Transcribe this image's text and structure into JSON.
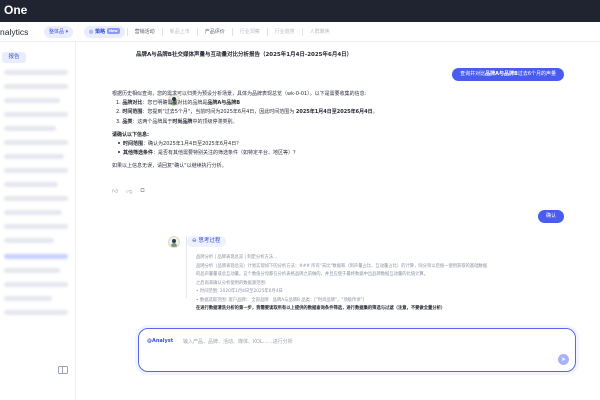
{
  "brand": {
    "logo_text": "One"
  },
  "header": {
    "app_name": "nalytics",
    "workspace": "整体品 ▾",
    "tabs": [
      {
        "label": "策略",
        "badge": "New",
        "state": "active"
      },
      {
        "label": "营销活动",
        "state": "normal"
      },
      {
        "label": "新品上市",
        "state": "dim"
      },
      {
        "label": "产品评价",
        "state": "normal"
      },
      {
        "label": "行业洞察",
        "state": "dim"
      },
      {
        "label": "行业趋势",
        "state": "dim"
      },
      {
        "label": "人群聚焦",
        "state": "dim"
      }
    ]
  },
  "sidebar": {
    "active_label": "报告",
    "items_count_blurred": 18
  },
  "report": {
    "title": "品牌A与品牌B社交媒体声量与互动量对比分析报告（2025年1月4日-2025年6月4日）"
  },
  "chat": {
    "user_message_1": {
      "prefix": "查询并对比",
      "brands": "品牌A与品牌B",
      "suffix": "过去6个月的声量"
    },
    "assistant_message": {
      "intro": "根据历史相似查询，您的需求可以归类为预设分析场景，具体为品牌表现总览（wk-0-01）。以下是需要收集的信息:",
      "items": [
        {
          "num": "1.",
          "key": "品牌对比",
          "text": "您已明确需要对比的品牌是",
          "value": "品牌A与品牌B"
        },
        {
          "num": "2.",
          "key": "时间范围",
          "text": "您提到\"过去5个月\"，当前时间为2025年6月4日，因此时间范围为",
          "value": "2025年1月4日至2025年6月4日"
        },
        {
          "num": "3.",
          "key": "品类",
          "text": "这两个品牌属于",
          "value": "时尚品牌",
          "tail": "中的顶级停滞类别"
        }
      ],
      "confirm_heading": "请确认以下信息:",
      "bullets": [
        {
          "key": "时间范围",
          "text": "确认为2025年1月4日至2025年6月4日？"
        },
        {
          "key": "其他筛选条件",
          "text": "是否有其他需要特别关注的筛选条件（如特定平台、地区等）？"
        }
      ],
      "closing": "如果以上信息无误，请回复\"确认\"以继续执行分析。"
    },
    "user_message_2": "确认",
    "thinking": {
      "toggle_label": "思考过程",
      "lines": [
        "品牌分析 | 品牌表现总览 | 制定分析方法...",
        "品牌分析（品牌表现总览）计划实现如下的分析方法：### 所有\"去比\"数据和（到声量占比、互动量占比）的计算，除分项以后统一使用获取的基础数据",
        "的品声量量或总互动量。这个数值分母都在分析表格品牌之前做的，并且应使于最终数据中出品牌数据互动量的比值计算。",
        "之后再来确认分析使用的数据源范围:",
        "• 时间范围: 2020年1月4日至2025年6月4日",
        "• 数据选取范围: 客户品牌： 全部品牌 · 品牌A与品牌B  品类：[\"时尚品牌\"，\"顶级传承\"]"
      ],
      "hint": "在进行数据清洗分析的第一步，我需要读取所有以上提供的数据查询条件筛选，进行数据集的筛选与过滤（注意，不要做全量分析）"
    },
    "action_icons": [
      "thumb-up-icon",
      "thumb-down-icon",
      "copy-icon"
    ]
  },
  "input": {
    "prefix": "@Analyst",
    "placeholder": "输入产品、品牌、活动、媒体、KOL……进行分析",
    "send_icon": "send-icon"
  },
  "colors": {
    "accent": "#4a5cf0",
    "accent_light": "#e9eeff",
    "dark": "#1f2430"
  }
}
